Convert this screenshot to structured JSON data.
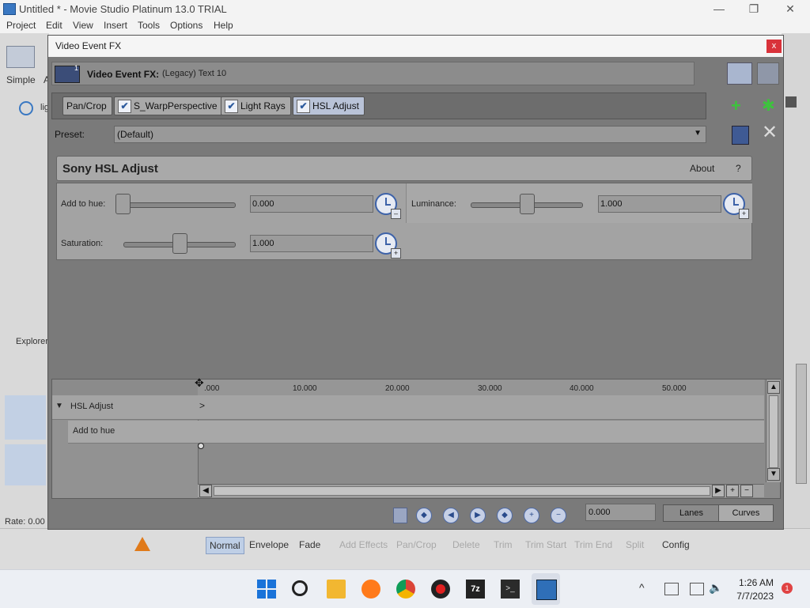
{
  "window": {
    "title": "Untitled * - Movie Studio Platinum 13.0 TRIAL",
    "minimize": "—",
    "maximize": "❐",
    "close": "✕"
  },
  "menu": [
    "Project",
    "Edit",
    "View",
    "Insert",
    "Tools",
    "Options",
    "Help"
  ],
  "background": {
    "simple_label": "Simple",
    "a_label": "A",
    "lig_label": "lig",
    "explorer_label": "Explorer",
    "rate_label": "Rate: 0.00",
    "bottom_tabs": [
      {
        "label": "Normal",
        "state": "selected"
      },
      {
        "label": "Envelope",
        "state": "normal"
      },
      {
        "label": "Fade",
        "state": "normal"
      },
      {
        "label": "Add Effects",
        "state": "disabled"
      },
      {
        "label": "Pan/Crop",
        "state": "disabled"
      },
      {
        "label": "Delete",
        "state": "disabled"
      },
      {
        "label": "Trim",
        "state": "disabled"
      },
      {
        "label": "Trim Start",
        "state": "disabled"
      },
      {
        "label": "Trim End",
        "state": "disabled"
      },
      {
        "label": "Split",
        "state": "disabled"
      },
      {
        "label": "Config",
        "state": "normal"
      }
    ]
  },
  "dialog": {
    "title": "Video Event FX",
    "close": "x",
    "fx_header_label": "Video Event FX:",
    "fx_header_value": "(Legacy) Text 10",
    "fx_header_badge": "1",
    "chain": [
      {
        "label": "Pan/Crop",
        "checked": false
      },
      {
        "label": "S_WarpPerspective",
        "checked": true
      },
      {
        "label": "Light Rays",
        "checked": true
      },
      {
        "label": "HSL Adjust",
        "checked": true,
        "active": true
      }
    ],
    "check_glyph": "✔",
    "preset_label": "Preset:",
    "preset_value": "(Default)",
    "panel": {
      "title": "Sony HSL Adjust",
      "about": "About",
      "help": "?",
      "params": [
        {
          "label": "Add to hue:",
          "value": "0.000",
          "position": 0.0
        },
        {
          "label": "Saturation:",
          "value": "1.000",
          "position": 0.5
        },
        {
          "label": "Luminance:",
          "value": "1.000",
          "position": 0.5
        }
      ],
      "keyframe_minus": "–",
      "keyframe_plus": "+"
    },
    "timeline": {
      "ticks": [
        ".000",
        "10.000",
        "20.000",
        "30.000",
        "40.000",
        "50.000"
      ],
      "track_name": "HSL Adjust",
      "param_name": "Add to hue"
    },
    "time_field": "0.000",
    "lanes_label": "Lanes",
    "curves_label": "Curves"
  },
  "taskbar": {
    "time": "1:26 AM",
    "date": "7/7/2023",
    "notifications": "1",
    "chevron": "^"
  }
}
